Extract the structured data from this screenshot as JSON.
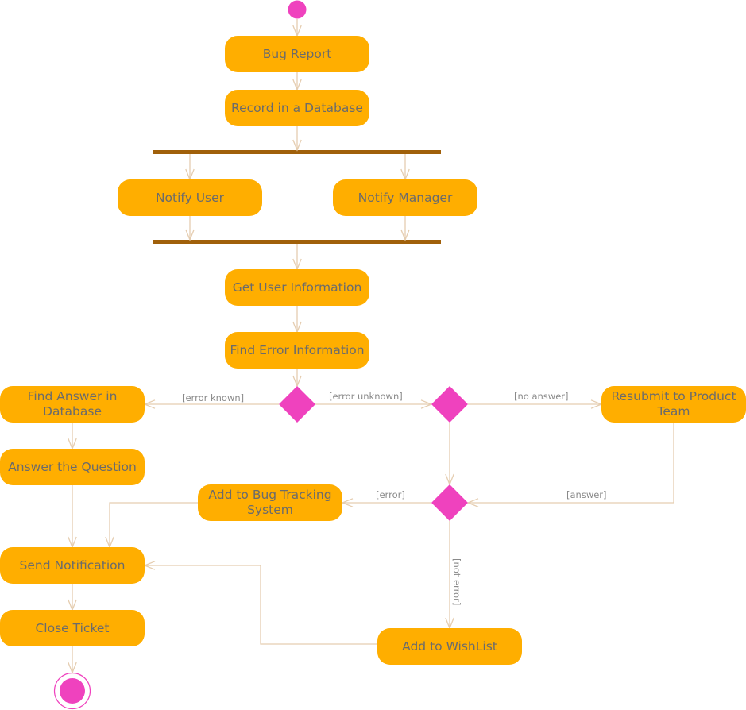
{
  "diagram": {
    "type": "UML activity diagram",
    "colors": {
      "action_fill": "#FFAE00",
      "action_text": "#6B6B6B",
      "decision_fill": "#EF42BE",
      "bar_fill": "#A0600A",
      "flow_line": "#E5CDB0",
      "guard_text": "#8A8A8A"
    },
    "start_node": {
      "id": "start"
    },
    "end_node": {
      "id": "end"
    },
    "actions": [
      {
        "id": "bug_report",
        "label": "Bug Report"
      },
      {
        "id": "record_db",
        "label": "Record in a Database"
      },
      {
        "id": "notify_user",
        "label": "Notify User"
      },
      {
        "id": "notify_manager",
        "label": "Notify Manager"
      },
      {
        "id": "get_user_info",
        "label": "Get User Information"
      },
      {
        "id": "find_error_info",
        "label": "Find Error Information"
      },
      {
        "id": "find_answer_db",
        "label": "Find Answer in Database"
      },
      {
        "id": "resubmit",
        "label": "Resubmit to Product Team"
      },
      {
        "id": "answer_question",
        "label": "Answer the Question"
      },
      {
        "id": "add_bug_tracking",
        "label": "Add to Bug Tracking System"
      },
      {
        "id": "send_notification",
        "label": "Send Notification"
      },
      {
        "id": "close_ticket",
        "label": "Close Ticket"
      },
      {
        "id": "add_wishlist",
        "label": "Add to WishList"
      }
    ],
    "fork_join_bars": [
      {
        "id": "fork1",
        "kind": "fork"
      },
      {
        "id": "join1",
        "kind": "join"
      }
    ],
    "decisions": [
      {
        "id": "d_error_known"
      },
      {
        "id": "d_answer"
      },
      {
        "id": "d_error"
      }
    ],
    "guards": {
      "error_known": "[error known]",
      "error_unknown": "[error unknown]",
      "no_answer": "[no answer]",
      "answer": "[answer]",
      "error": "[error]",
      "not_error": "[not error]"
    },
    "flows": [
      {
        "from": "start",
        "to": "bug_report"
      },
      {
        "from": "bug_report",
        "to": "record_db"
      },
      {
        "from": "record_db",
        "to": "fork1"
      },
      {
        "from": "fork1",
        "to": "notify_user"
      },
      {
        "from": "fork1",
        "to": "notify_manager"
      },
      {
        "from": "notify_user",
        "to": "join1"
      },
      {
        "from": "notify_manager",
        "to": "join1"
      },
      {
        "from": "join1",
        "to": "get_user_info"
      },
      {
        "from": "get_user_info",
        "to": "find_error_info"
      },
      {
        "from": "find_error_info",
        "to": "d_error_known"
      },
      {
        "from": "d_error_known",
        "to": "find_answer_db",
        "guard": "[error known]"
      },
      {
        "from": "d_error_known",
        "to": "d_answer",
        "guard": "[error unknown]"
      },
      {
        "from": "d_answer",
        "to": "resubmit",
        "guard": "[no answer]"
      },
      {
        "from": "d_answer",
        "to": "d_error"
      },
      {
        "from": "resubmit",
        "to": "d_error",
        "guard": "[answer]"
      },
      {
        "from": "d_error",
        "to": "add_bug_tracking",
        "guard": "[error]"
      },
      {
        "from": "d_error",
        "to": "add_wishlist",
        "guard": "[not error]"
      },
      {
        "from": "find_answer_db",
        "to": "answer_question"
      },
      {
        "from": "answer_question",
        "to": "send_notification"
      },
      {
        "from": "add_bug_tracking",
        "to": "send_notification"
      },
      {
        "from": "add_wishlist",
        "to": "send_notification"
      },
      {
        "from": "send_notification",
        "to": "close_ticket"
      },
      {
        "from": "close_ticket",
        "to": "end"
      }
    ]
  }
}
